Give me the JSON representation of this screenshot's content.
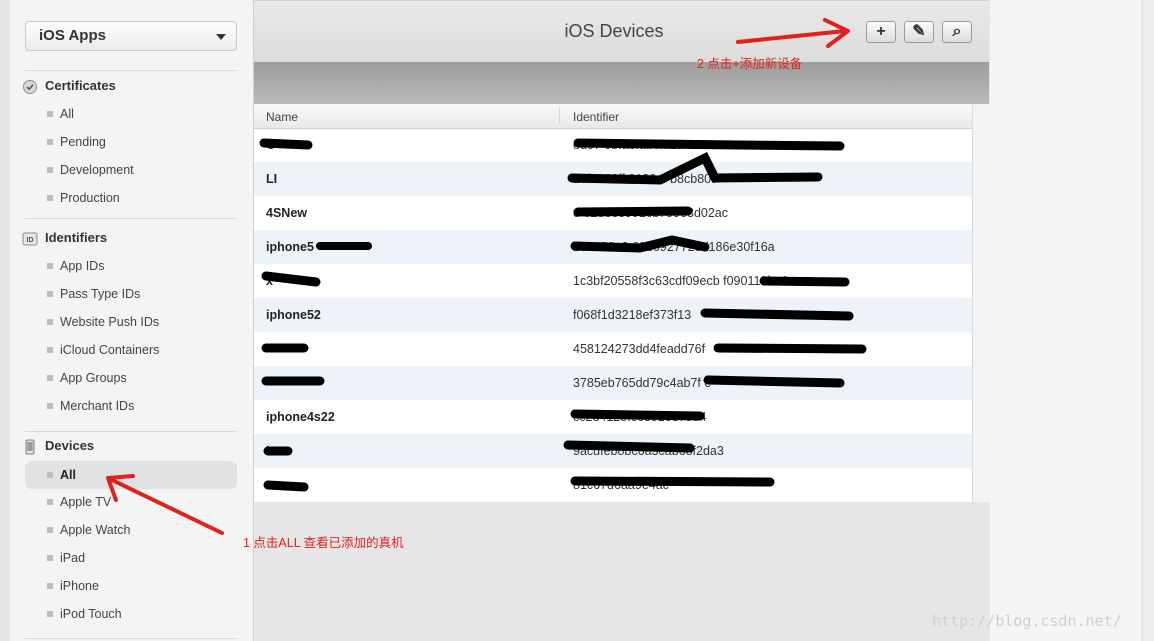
{
  "sidebar": {
    "platform_label": "iOS Apps",
    "sections": [
      {
        "title": "Certificates",
        "icon": "certificate-badge-icon",
        "items": [
          {
            "label": "All"
          },
          {
            "label": "Pending"
          },
          {
            "label": "Development"
          },
          {
            "label": "Production"
          }
        ]
      },
      {
        "title": "Identifiers",
        "icon": "id-card-icon",
        "items": [
          {
            "label": "App IDs"
          },
          {
            "label": "Pass Type IDs"
          },
          {
            "label": "Website Push IDs"
          },
          {
            "label": "iCloud Containers"
          },
          {
            "label": "App Groups"
          },
          {
            "label": "Merchant IDs"
          }
        ]
      },
      {
        "title": "Devices",
        "icon": "device-phone-icon",
        "items": [
          {
            "label": "All",
            "active": true
          },
          {
            "label": "Apple TV"
          },
          {
            "label": "Apple Watch"
          },
          {
            "label": "iPad"
          },
          {
            "label": "iPhone"
          },
          {
            "label": "iPod Touch"
          }
        ]
      }
    ]
  },
  "header": {
    "title": "iOS Devices",
    "buttons": [
      {
        "icon": "plus-icon",
        "glyph": "+"
      },
      {
        "icon": "edit-pencil-icon",
        "glyph": "✎"
      },
      {
        "icon": "search-icon",
        "glyph": "⌕"
      }
    ]
  },
  "table": {
    "columns": {
      "name": "Name",
      "identifier": "Identifier"
    },
    "rows": [
      {
        "name": "O",
        "identifier": "ed07 0bfabfabcfa2a420a"
      },
      {
        "name": "LI",
        "identifier": "20f5362ff 8120 4 b8cb809"
      },
      {
        "name": "4SNew",
        "identifier": "e 62d663992cb75963d02ac"
      },
      {
        "name": "iphone5",
        "identifier": "230a36e3 6930927728d186e30f16a"
      },
      {
        "name": "x",
        "identifier": "1c3bf20558f3c63cdf09ecb f090119be1a"
      },
      {
        "name": "iphone52",
        "identifier": "f068f1d3218ef373f13"
      },
      {
        "name": "",
        "identifier": "458124273dd4feadd76f"
      },
      {
        "name": "",
        "identifier": "3785eb765dd79c4ab7f e"
      },
      {
        "name": "iphone4s22",
        "identifier": "cc2d4125f0c381637904"
      },
      {
        "name": "L",
        "identifier": "9acdfeb8bc6a3cab68f2da3"
      },
      {
        "name": "",
        "identifier": "81c67d6aa9e4ac"
      }
    ]
  },
  "annotations": {
    "step1": "1 点击ALL 查看已添加的真机",
    "step2": "2 点击+添加新设备",
    "accent_color": "#e0221b"
  },
  "watermark": "http://blog.csdn.net/"
}
